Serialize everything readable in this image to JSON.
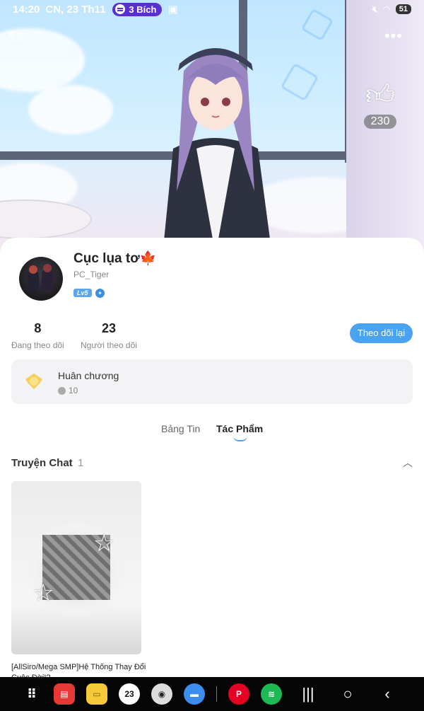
{
  "status": {
    "time": "14:20",
    "date": "CN, 23 Th11",
    "music_pill": "3 Bích",
    "battery": "51"
  },
  "profile": {
    "display_name": "Cục lụa tơ🍁",
    "username": "PC_Tiger",
    "level": "Lv5",
    "likes": "230",
    "following_count": "8",
    "following_label": "Đang theo dõi",
    "followers_count": "23",
    "followers_label": "Người theo dõi",
    "follow_button": "Theo dõi lại"
  },
  "medal": {
    "title": "Huân chương",
    "count": "10"
  },
  "tabs": [
    {
      "label": "Bảng Tin",
      "active": false
    },
    {
      "label": "Tác Phẩm",
      "active": true
    }
  ],
  "section": {
    "title": "Truyện Chat",
    "count": "1"
  },
  "stories": [
    {
      "title": "[AllSiro/Mega SMP]Hệ Thống Thay Đổi Cuộc Đời!?"
    }
  ],
  "navbar": {
    "apps": [
      "apps-grid",
      "notes",
      "files",
      "calendar",
      "camera",
      "messages",
      "pinterest",
      "spotify"
    ],
    "calendar_day": "23"
  },
  "colors": {
    "accent": "#4aa3f0",
    "spotify_pill": "#5a2fd2"
  }
}
